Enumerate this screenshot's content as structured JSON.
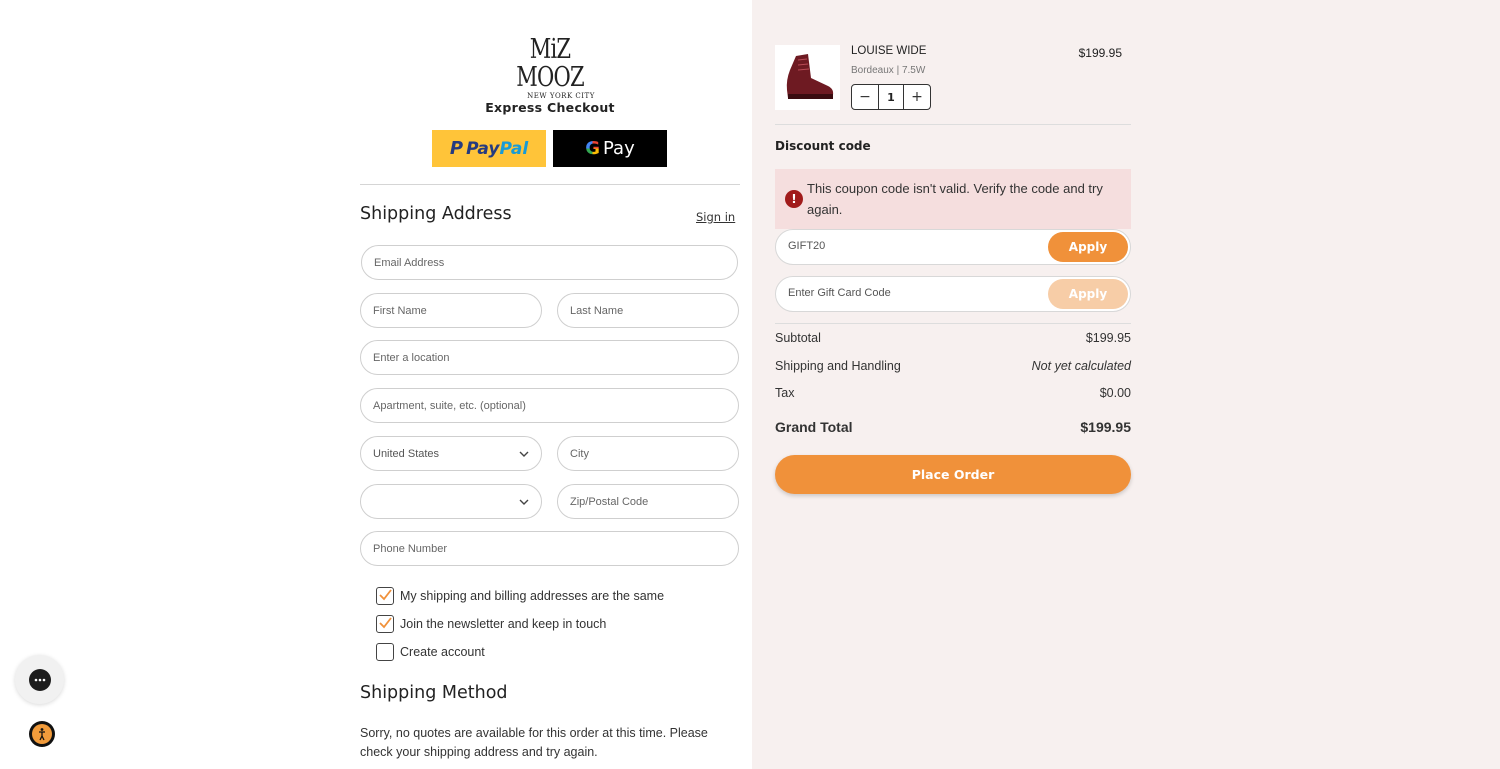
{
  "brand": {
    "logo_main": "MiZ MOOZ",
    "logo_sub": "NEW YORK CITY"
  },
  "express": {
    "title": "Express Checkout",
    "paypal_label_1": "Pay",
    "paypal_label_2": "Pal",
    "gpay_g": "G",
    "gpay_label": "Pay"
  },
  "shipping": {
    "title": "Shipping Address",
    "sign_in": "Sign in",
    "fields": {
      "email": "Email Address",
      "first_name": "First Name",
      "last_name": "Last Name",
      "location": "Enter a location",
      "apartment": "Apartment, suite, etc. (optional)",
      "country": "United States",
      "city": "City",
      "state": "",
      "zip": "Zip/Postal Code",
      "phone": "Phone Number"
    },
    "checkboxes": [
      {
        "label": "My shipping and billing addresses are the same",
        "checked": true
      },
      {
        "label": "Join the newsletter and keep in touch",
        "checked": true
      },
      {
        "label": "Create account",
        "checked": false
      }
    ]
  },
  "shipping_method": {
    "title": "Shipping Method",
    "message": "Sorry, no quotes are available for this order at this time. Please check your shipping address and try again."
  },
  "cart": {
    "item": {
      "name": "LOUISE WIDE",
      "variant": "Bordeaux  |  7.5W",
      "price": "$199.95",
      "qty": "1",
      "minus": "−",
      "plus": "+"
    }
  },
  "discount": {
    "title": "Discount code",
    "error": "This coupon code isn't valid. Verify the code and try again.",
    "error_icon": "!",
    "coupon_value": "GIFT20",
    "apply": "Apply",
    "gift_placeholder": "Enter Gift Card Code",
    "gift_apply": "Apply"
  },
  "summary": {
    "subtotal_label": "Subtotal",
    "subtotal": "$199.95",
    "shipping_label": "Shipping and Handling",
    "shipping": "Not yet calculated",
    "tax_label": "Tax",
    "tax": "$0.00",
    "grand_label": "Grand Total",
    "grand": "$199.95"
  },
  "place_order": "Place Order",
  "colors": {
    "accent": "#f0913a",
    "accent_disabled": "#f7cda7",
    "error_bg": "#f5dede",
    "error_icon": "#a11b1b",
    "right_bg": "#f7f0ef"
  },
  "icons": {
    "chat": "chat-bubble-icon",
    "accessibility": "accessibility-icon",
    "chevron": "chevron-down-icon",
    "error": "error-icon"
  }
}
